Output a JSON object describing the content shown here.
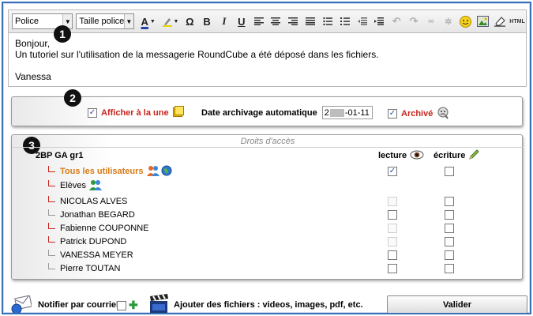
{
  "toolbar": {
    "font_select": "Police",
    "size_select": "Taille police",
    "bold": "B",
    "italic": "I",
    "underline": "U",
    "omega": "Ω",
    "html_label": "HTML"
  },
  "editor": {
    "lines": [
      "Bonjour,",
      "Un tutoriel sur l'utilisation de la messagerie RoundCube a été déposé dans les fichiers.",
      "",
      "Vanessa"
    ]
  },
  "badges": [
    "1",
    "2",
    "3"
  ],
  "options": {
    "afficher_label": "Afficher à la une",
    "afficher_checked": true,
    "date_label": "Date archivage automatique",
    "date_value_prefix": "2",
    "date_value_suffix": "-01-11",
    "archive_label": "Archivé",
    "archive_checked": true
  },
  "rights": {
    "title": "Droits d'accès",
    "group": "2BP GA gr1",
    "col_lecture": "lecture",
    "col_ecriture": "écriture",
    "rows": [
      {
        "name": "Tous les utilisateurs",
        "hook": "red",
        "style": "orange",
        "lecture": "checked",
        "ecriture": "unchecked"
      },
      {
        "name": "Elèves",
        "hook": "red",
        "style": "normal",
        "lecture": "none",
        "ecriture": "none"
      },
      {
        "name": "NICOLAS ALVES",
        "hook": "red",
        "style": "normal",
        "lecture": "disabled",
        "ecriture": "unchecked"
      },
      {
        "name": "Jonathan BEGARD",
        "hook": "grey",
        "style": "normal",
        "lecture": "unchecked",
        "ecriture": "unchecked"
      },
      {
        "name": "Fabienne COUPONNE",
        "hook": "red",
        "style": "normal",
        "lecture": "disabled",
        "ecriture": "unchecked"
      },
      {
        "name": "Patrick DUPOND",
        "hook": "red",
        "style": "normal",
        "lecture": "disabled",
        "ecriture": "unchecked"
      },
      {
        "name": "VANESSA MEYER",
        "hook": "grey",
        "style": "normal",
        "lecture": "unchecked",
        "ecriture": "unchecked"
      },
      {
        "name": "Pierre TOUTAN",
        "hook": "grey",
        "style": "normal",
        "lecture": "unchecked",
        "ecriture": "unchecked"
      }
    ]
  },
  "bottom": {
    "notifier_label": "Notifier par courriel",
    "ajouter_label": "Ajouter des fichiers : videos, images, pdf, etc.",
    "valider_label": "Valider"
  },
  "colors": {
    "frame_blue": "#3b6fb6",
    "accent_red": "#c8241c",
    "accent_orange": "#d97a16"
  }
}
